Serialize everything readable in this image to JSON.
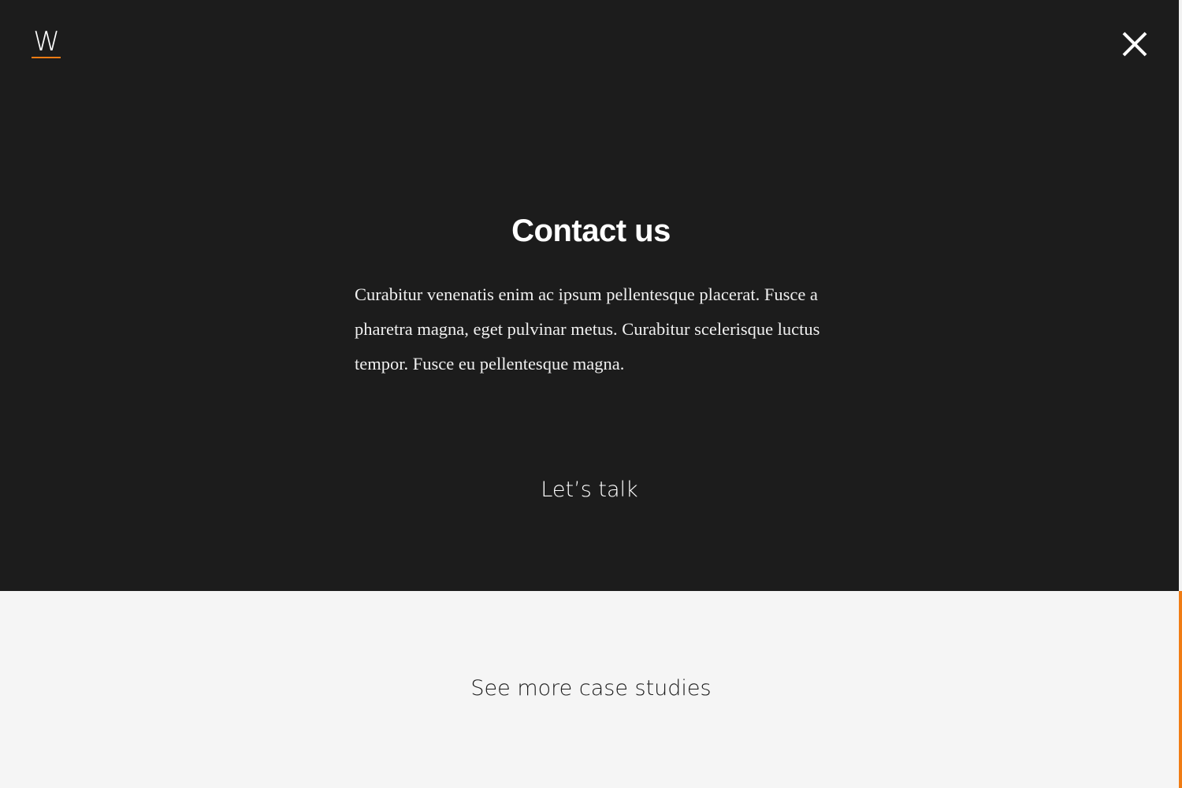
{
  "header": {
    "logo_letter": "W",
    "close_label": "×"
  },
  "contact": {
    "title": "Contact us",
    "description": "Curabitur venenatis enim ac ipsum pellentesque placerat. Fusce a pharetra magna, eget pulvinar metus. Curabitur scelerisque luctus tempor. Fusce eu pellentesque magna.",
    "cta_label": "Let’s talk"
  },
  "footer": {
    "case_studies_label": "See more case studies"
  },
  "colors": {
    "dark_background": "#1c1c1c",
    "light_background": "#f5f5f5",
    "accent": "#f07c14",
    "text_light": "#ffffff",
    "text_dark": "#1c1c1c"
  },
  "icons": {
    "close": "close-icon",
    "logo": "logo-icon"
  }
}
